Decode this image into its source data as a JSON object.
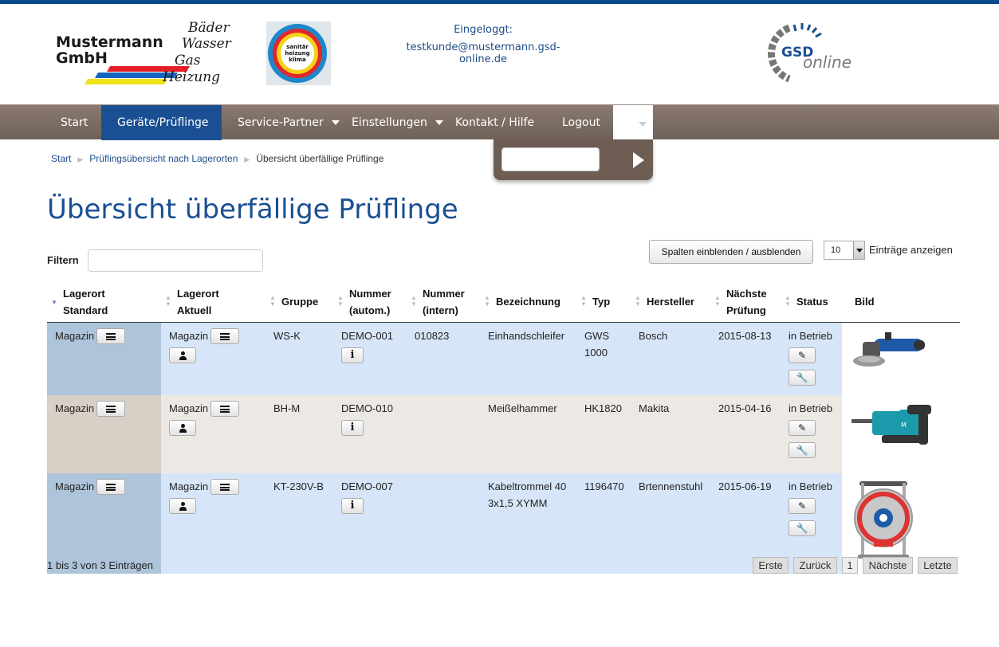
{
  "header": {
    "logo_name_line1": "Mustermann",
    "logo_name_line2": "GmbH",
    "logo_words": [
      "Bäder",
      "Wasser",
      "Gas",
      "Heizung"
    ],
    "round_logo_lines": [
      "sanitär",
      "heizung",
      "klima"
    ],
    "login_label": "Eingeloggt:",
    "login_email": "testkunde@mustermann.gsd-online.de",
    "gsd_logo_top": "GSD",
    "gsd_logo_bottom": "online"
  },
  "nav": {
    "items": [
      {
        "label": "Start"
      },
      {
        "label": "Geräte/Prüflinge"
      },
      {
        "label": "Service-Partner"
      },
      {
        "label": "Einstellungen"
      },
      {
        "label": "Kontakt / Hilfe"
      },
      {
        "label": "Logout"
      }
    ]
  },
  "breadcrumb": {
    "items": [
      "Start",
      "Prüflingsübersicht nach Lagerorten",
      "Übersicht überfällige Prüflinge"
    ]
  },
  "page": {
    "title": "Übersicht überfällige Prüflinge",
    "filter_label": "Filtern",
    "colvis_label": "Spalten einblenden / ausblenden",
    "length_value": "10",
    "length_label": "Einträge anzeigen",
    "info": "1 bis 3 von 3 Einträgen"
  },
  "table": {
    "headers": [
      [
        "Lagerort",
        "Standard"
      ],
      [
        "Lagerort",
        "Aktuell"
      ],
      [
        "Gruppe"
      ],
      [
        "Nummer",
        "(autom.)"
      ],
      [
        "Nummer",
        "(intern)"
      ],
      [
        "Bezeichnung"
      ],
      [
        "Typ"
      ],
      [
        "Hersteller"
      ],
      [
        "Nächste",
        "Prüfung"
      ],
      [
        "Status"
      ],
      [
        "Bild"
      ]
    ],
    "rows": [
      {
        "lager_std": "Magazin",
        "lager_akt": "Magazin",
        "gruppe": "WS-K",
        "nr_autom": "DEMO-001",
        "nr_intern": "010823",
        "bez1": "Einhandschleifer",
        "bez2": "",
        "typ1": "GWS",
        "typ2": "1000",
        "hersteller": "Bosch",
        "pruefung": "2015-08-13",
        "status": "in Betrieb",
        "image": "angle-grinder"
      },
      {
        "lager_std": "Magazin",
        "lager_akt": "Magazin",
        "gruppe": "BH-M",
        "nr_autom": "DEMO-010",
        "nr_intern": "",
        "bez1": "Meißelhammer",
        "bez2": "",
        "typ1": "HK1820",
        "typ2": "",
        "hersteller": "Makita",
        "pruefung": "2015-04-16",
        "status": "in Betrieb",
        "image": "demolition-hammer"
      },
      {
        "lager_std": "Magazin",
        "lager_akt": "Magazin",
        "gruppe": "KT-230V-B",
        "nr_autom": "DEMO-007",
        "nr_intern": "",
        "bez1": "Kabeltrommel 40",
        "bez2": "3x1,5 XYMM",
        "typ1": "1196470",
        "typ2": "",
        "hersteller": "Brtennenstuhl",
        "pruefung": "2015-06-19",
        "status": "in Betrieb",
        "image": "cable-reel"
      }
    ]
  },
  "pagination": {
    "first": "Erste",
    "prev": "Zurück",
    "page": "1",
    "next": "Nächste",
    "last": "Letzte"
  },
  "colors": {
    "brand_blue": "#1a4f93",
    "nav_brown": "#7d6e64",
    "row_blue": "#d6e6f8",
    "row_beige": "#ece8e3"
  }
}
